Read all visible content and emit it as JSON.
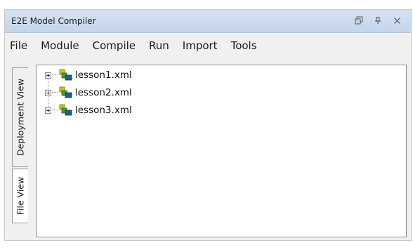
{
  "window": {
    "title": "E2E Model Compiler",
    "controls": [
      {
        "name": "restore-window-icon",
        "glyph": "⧉"
      },
      {
        "name": "pin-icon",
        "glyph": "⊥"
      },
      {
        "name": "close-icon",
        "glyph": "✕"
      }
    ]
  },
  "menu": {
    "items": [
      "File",
      "Module",
      "Compile",
      "Run",
      "Import",
      "Tools"
    ]
  },
  "side_tabs": [
    {
      "label": "Deployment View",
      "active": false
    },
    {
      "label": "File View",
      "active": true
    }
  ],
  "tree": {
    "items": [
      {
        "label": "lesson1.xml",
        "icon": "module-icon"
      },
      {
        "label": "lesson2.xml",
        "icon": "module-icon"
      },
      {
        "label": "lesson3.xml",
        "icon": "module-icon"
      }
    ]
  },
  "colors": {
    "titlebar": "#c9d9ee",
    "icon_yellow": "#c8c21e",
    "icon_green": "#4e9a3a",
    "icon_blue": "#1f5f8f"
  }
}
